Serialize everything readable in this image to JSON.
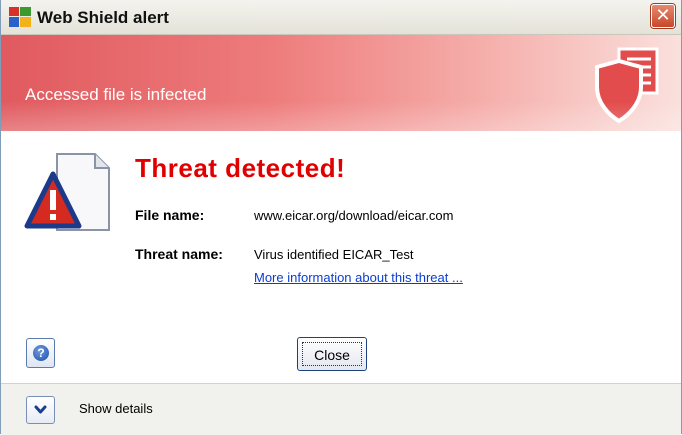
{
  "window": {
    "title": "Web Shield alert",
    "close_glyph": "✕"
  },
  "banner": {
    "text": "Accessed file is infected",
    "icon": "shield-document-icon"
  },
  "main": {
    "heading": "Threat detected!",
    "file_name_label": "File name:",
    "file_name_value": "www.eicar.org/download/eicar.com",
    "threat_name_label": "Threat name:",
    "threat_name_value": "Virus identified EICAR_Test",
    "more_info_link": "More information about this threat ..."
  },
  "buttons": {
    "help_glyph": "?",
    "close_label": "Close"
  },
  "footer": {
    "details_label": "Show details"
  },
  "colors": {
    "heading": "#e00000",
    "link": "#0a3cd0",
    "banner_start": "#e05a5f",
    "banner_end": "#fae0dd"
  }
}
